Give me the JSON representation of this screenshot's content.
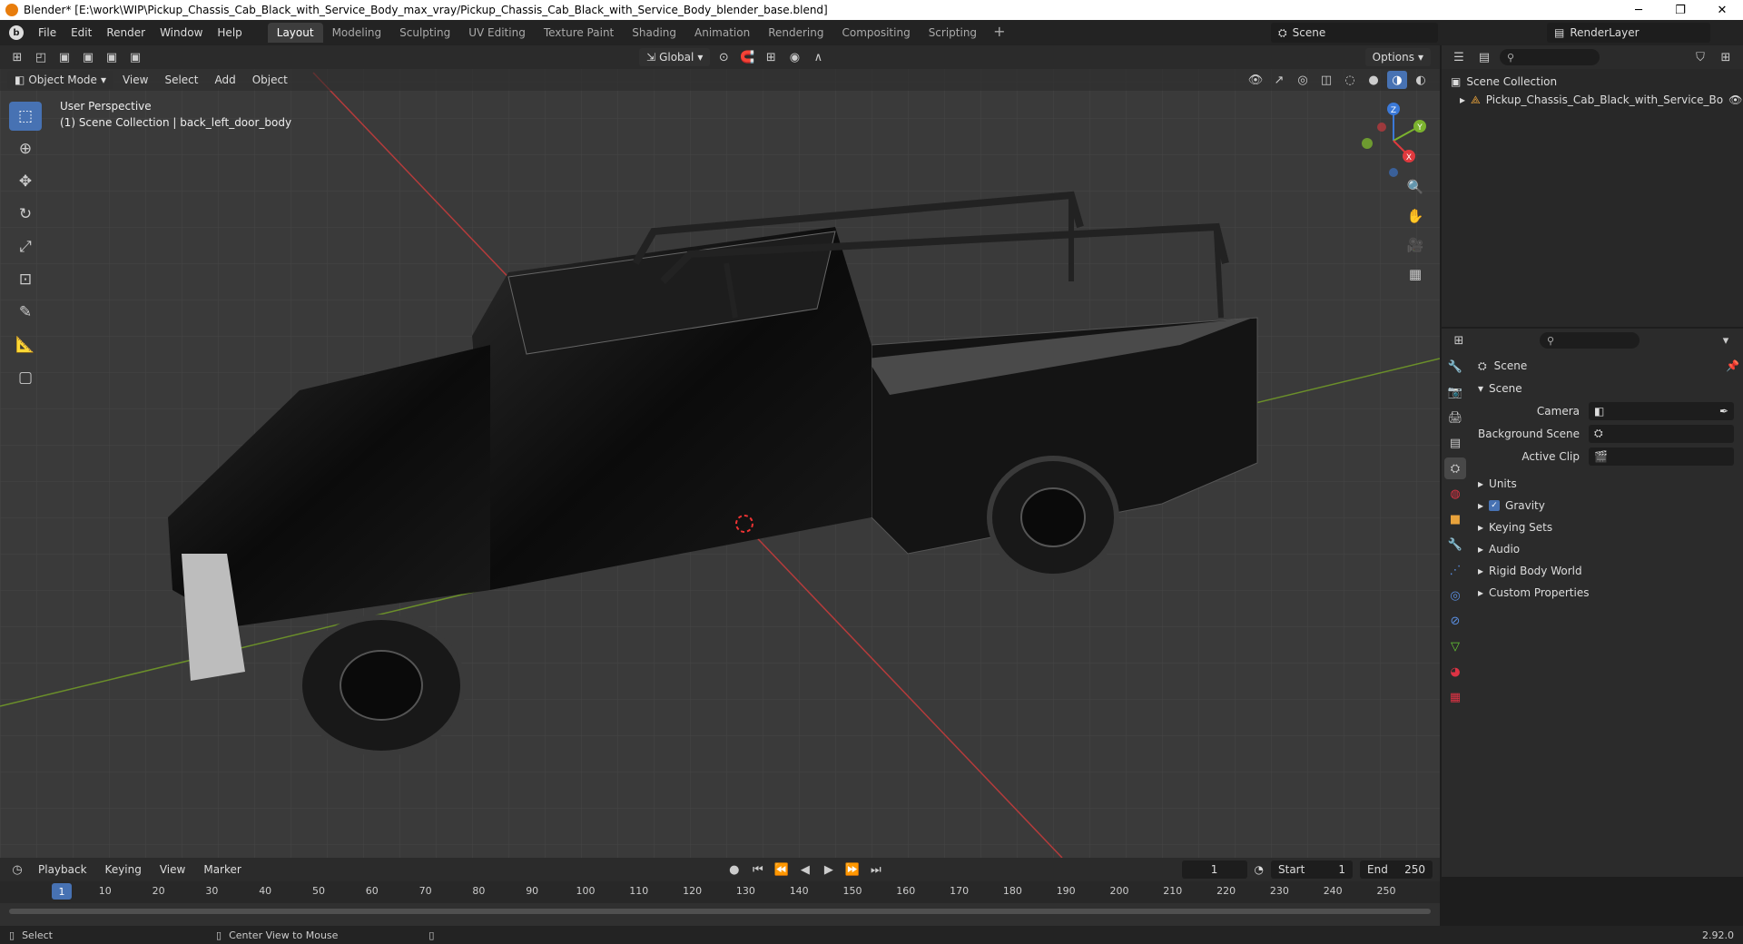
{
  "window": {
    "title": "Blender* [E:\\work\\WIP\\Pickup_Chassis_Cab_Black_with_Service_Body_max_vray/Pickup_Chassis_Cab_Black_with_Service_Body_blender_base.blend]",
    "minimize": "─",
    "restore": "❐",
    "close": "✕"
  },
  "menubar": {
    "items": [
      "File",
      "Edit",
      "Render",
      "Window",
      "Help"
    ],
    "workspaces": [
      "Layout",
      "Modeling",
      "Sculpting",
      "UV Editing",
      "Texture Paint",
      "Shading",
      "Animation",
      "Rendering",
      "Compositing",
      "Scripting"
    ],
    "active_workspace": "Layout",
    "add_tab": "+",
    "scene": "Scene",
    "render_layer": "RenderLayer"
  },
  "viewport": {
    "transform_orientation": "Global",
    "options": "Options",
    "mode": "Object Mode",
    "menus": [
      "View",
      "Select",
      "Add",
      "Object"
    ],
    "perspective": "User Perspective",
    "collection_info": "(1) Scene Collection | back_left_door_body",
    "gizmo": {
      "z": "Z",
      "y": "Y",
      "x": "X"
    }
  },
  "outliner": {
    "root": "Scene Collection",
    "items": [
      "Pickup_Chassis_Cab_Black_with_Service_Bo"
    ]
  },
  "properties": {
    "title": "Scene",
    "panel": "Scene",
    "fields": [
      {
        "label": "Camera",
        "value": ""
      },
      {
        "label": "Background Scene",
        "value": ""
      },
      {
        "label": "Active Clip",
        "value": ""
      }
    ],
    "sections": [
      "Units",
      "Gravity",
      "Keying Sets",
      "Audio",
      "Rigid Body World",
      "Custom Properties"
    ],
    "gravity_checked": true
  },
  "timeline": {
    "menus": [
      "Playback",
      "Keying",
      "View",
      "Marker"
    ],
    "current_frame": "1",
    "start_label": "Start",
    "start": "1",
    "end_label": "End",
    "end": "250",
    "ticks": [
      "10",
      "20",
      "30",
      "40",
      "50",
      "60",
      "70",
      "80",
      "90",
      "100",
      "110",
      "120",
      "130",
      "140",
      "150",
      "160",
      "170",
      "180",
      "190",
      "200",
      "210",
      "220",
      "230",
      "240",
      "250"
    ]
  },
  "statusbar": {
    "select": "Select",
    "center_view": "Center View to Mouse",
    "version": "2.92.0"
  }
}
